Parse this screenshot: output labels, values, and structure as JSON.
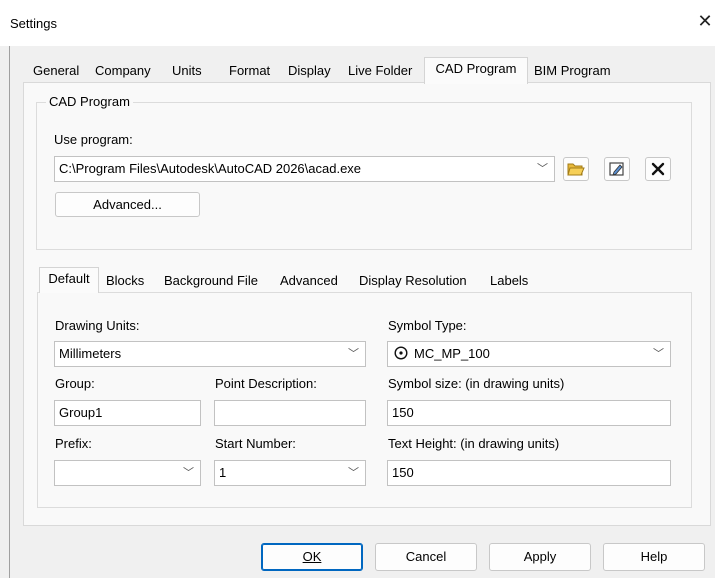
{
  "window": {
    "title": "Settings"
  },
  "tabs": [
    {
      "label": "General"
    },
    {
      "label": "Company"
    },
    {
      "label": "Units"
    },
    {
      "label": "Format"
    },
    {
      "label": "Display"
    },
    {
      "label": "Live Folder"
    },
    {
      "label": "CAD Program",
      "active": true
    },
    {
      "label": "BIM Program"
    }
  ],
  "cad_program": {
    "group_title": "CAD Program",
    "use_program_label": "Use program:",
    "program_path": "C:\\Program Files\\Autodesk\\AutoCAD 2026\\acad.exe",
    "advanced_button": "Advanced..."
  },
  "subtabs": [
    {
      "label": "Default",
      "active": true
    },
    {
      "label": "Blocks"
    },
    {
      "label": "Background File"
    },
    {
      "label": "Advanced"
    },
    {
      "label": "Display Resolution"
    },
    {
      "label": "Labels"
    }
  ],
  "default_tab": {
    "drawing_units_label": "Drawing Units:",
    "drawing_units_value": "Millimeters",
    "symbol_type_label": "Symbol Type:",
    "symbol_type_value": "MC_MP_100",
    "group_label": "Group:",
    "group_value": "Group1",
    "point_description_label": "Point Description:",
    "point_description_value": "",
    "symbol_size_label": "Symbol size: (in drawing units)",
    "symbol_size_value": "150",
    "prefix_label": "Prefix:",
    "prefix_value": "",
    "start_number_label": "Start Number:",
    "start_number_value": "1",
    "text_height_label": "Text Height: (in drawing units)",
    "text_height_value": "150"
  },
  "buttons": {
    "ok": "OK",
    "cancel": "Cancel",
    "apply": "Apply",
    "help": "Help"
  },
  "colors": {
    "accent": "#0067c0",
    "folder_icon": "#e8b93a"
  }
}
